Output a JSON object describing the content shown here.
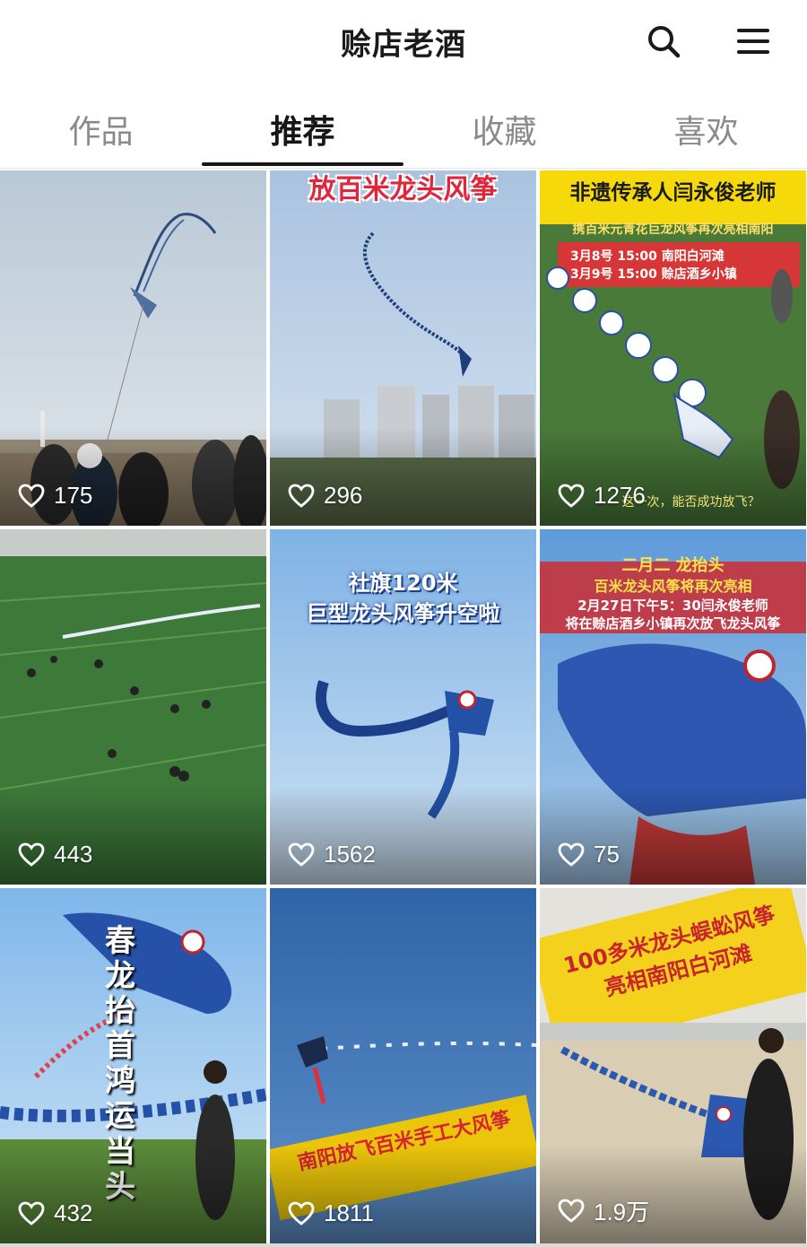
{
  "header": {
    "title": "赊店老酒",
    "search_icon": "search-icon",
    "menu_icon": "menu-icon"
  },
  "tabs": [
    {
      "label": "作品",
      "active": false
    },
    {
      "label": "推荐",
      "active": true
    },
    {
      "label": "收藏",
      "active": false
    },
    {
      "label": "喜欢",
      "active": false
    }
  ],
  "videos": [
    {
      "likes": "175",
      "captions": []
    },
    {
      "likes": "296",
      "captions": [
        "放百米龙头风筝"
      ]
    },
    {
      "likes": "1276",
      "captions": [
        "非遗传承人闫永俊老师",
        "携百米元青花巨龙风筝再次亮相南阳",
        "3月8号  15:00  南阳白河滩",
        "3月9号  15:00  赊店酒乡小镇",
        "这一次，能否成功放飞？"
      ]
    },
    {
      "likes": "443",
      "captions": []
    },
    {
      "likes": "1562",
      "captions": [
        "社旗120米",
        "巨型龙头风筝升空啦"
      ]
    },
    {
      "likes": "75",
      "captions": [
        "二月二 龙抬头",
        "百米龙头风筝将再次亮相",
        "2月27日下午5：30闫永俊老师",
        "将在赊店酒乡小镇再次放飞龙头风筝"
      ]
    },
    {
      "likes": "432",
      "captions": [
        "春龙抬首鸿运当头"
      ]
    },
    {
      "likes": "1811",
      "captions": [
        "南阳放飞百米手工大风筝"
      ]
    },
    {
      "likes": "1.9万",
      "captions": [
        "100多米龙头蜈蚣风筝",
        "亮相南阳白河滩"
      ]
    }
  ],
  "colors": {
    "accent": "#161616",
    "inactive_tab": "#8a8a8a",
    "caption_red": "#e1263b",
    "caption_yellow": "#ffd400"
  }
}
